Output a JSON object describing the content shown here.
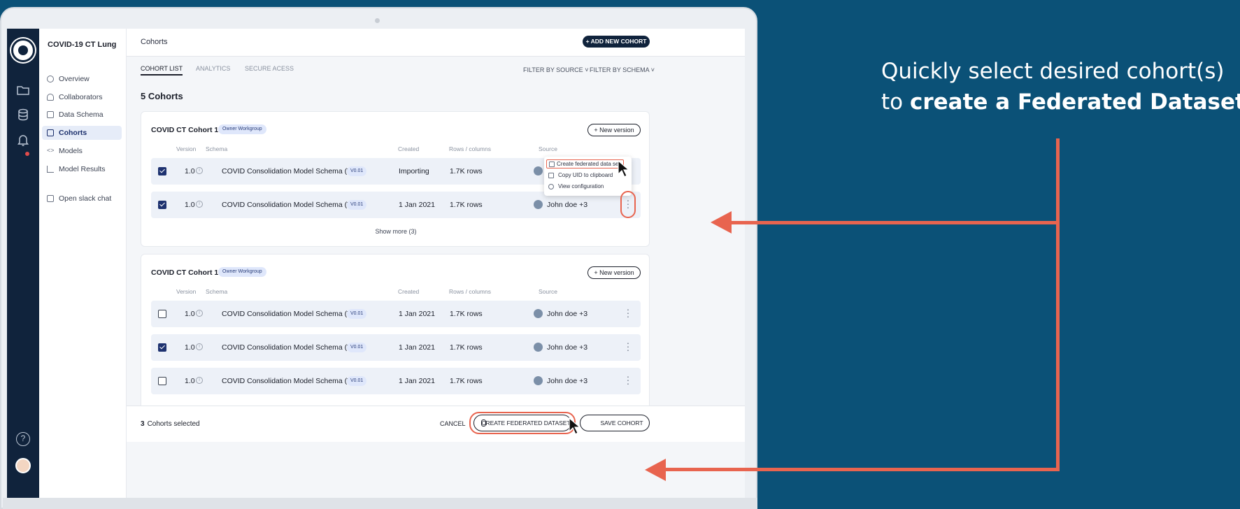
{
  "app": {
    "project_name": "COVID-19 CT Lung"
  },
  "sidebar": {
    "items": [
      {
        "label": "Overview",
        "icon": "overview-icon",
        "active": false
      },
      {
        "label": "Collaborators",
        "icon": "collaborators-icon",
        "active": false
      },
      {
        "label": "Data Schema",
        "icon": "table-icon",
        "active": false
      },
      {
        "label": "Cohorts",
        "icon": "cohorts-icon",
        "active": true
      },
      {
        "label": "Models",
        "icon": "code-icon",
        "active": false
      },
      {
        "label": "Model Results",
        "icon": "chart-icon",
        "active": false
      },
      {
        "label": "Open slack chat",
        "icon": "external-link-icon",
        "active": false
      }
    ]
  },
  "header": {
    "breadcrumb": "Cohorts",
    "add_button": "+ ADD NEW COHORT"
  },
  "tabs": [
    "COHORT LIST",
    "ANALYTICS",
    "SECURE ACESS"
  ],
  "filters": {
    "source": "FILTER BY SOURCE",
    "schema": "FILTER BY SCHEMA"
  },
  "count_label": "5 Cohorts",
  "columns": {
    "version": "Version",
    "schema": "Schema",
    "created": "Created",
    "rows": "Rows / columns",
    "source": "Source"
  },
  "cohorts": [
    {
      "title": "COVID CT Cohort 1",
      "badge": "Owner Workgroup",
      "new_version": "+ New version",
      "rows": [
        {
          "checked": true,
          "version": "1.0",
          "schema": "COVID Consolidation Model Schema (V.1)",
          "schema_badge": "V0.01",
          "created": "Importing",
          "rows": "1.7K rows",
          "source": ""
        },
        {
          "checked": true,
          "version": "1.0",
          "schema": "COVID Consolidation Model Schema (V.1)",
          "schema_badge": "V0.01",
          "created": "1 Jan 2021",
          "rows": "1.7K rows",
          "source": "John doe +3"
        }
      ],
      "show_more": "Show more (3)"
    },
    {
      "title": "COVID CT Cohort 1",
      "badge": "Owner Workgroup",
      "new_version": "+ New version",
      "rows": [
        {
          "checked": false,
          "version": "1.0",
          "schema": "COVID Consolidation Model Schema (V.1)",
          "schema_badge": "V0.01",
          "created": "1 Jan 2021",
          "rows": "1.7K rows",
          "source": "John doe +3"
        },
        {
          "checked": true,
          "version": "1.0",
          "schema": "COVID Consolidation Model Schema (V.1)",
          "schema_badge": "V0.01",
          "created": "1 Jan 2021",
          "rows": "1.7K rows",
          "source": "John doe +3"
        },
        {
          "checked": false,
          "version": "1.0",
          "schema": "COVID Consolidation Model Schema (V.1)",
          "schema_badge": "V0.01",
          "created": "1 Jan 2021",
          "rows": "1.7K rows",
          "source": "John doe +3"
        }
      ]
    }
  ],
  "context_menu": [
    "Create federated data set",
    "Copy UID to clipboard",
    "View configuration"
  ],
  "footer": {
    "count": "3",
    "selected_label": "Cohorts selected",
    "cancel": "CANCEL",
    "create": "CREATE FEDERATED DATASET",
    "secondary": "SAVE COHORT"
  },
  "callout": {
    "line1": "Quickly select desired cohort(s)",
    "line2_prefix": "to ",
    "line2_bold": "create a Federated Dataset",
    "line2_suffix": "."
  },
  "colors": {
    "background": "#0b5177",
    "accent": "#e8644f",
    "nav": "#10233c"
  }
}
